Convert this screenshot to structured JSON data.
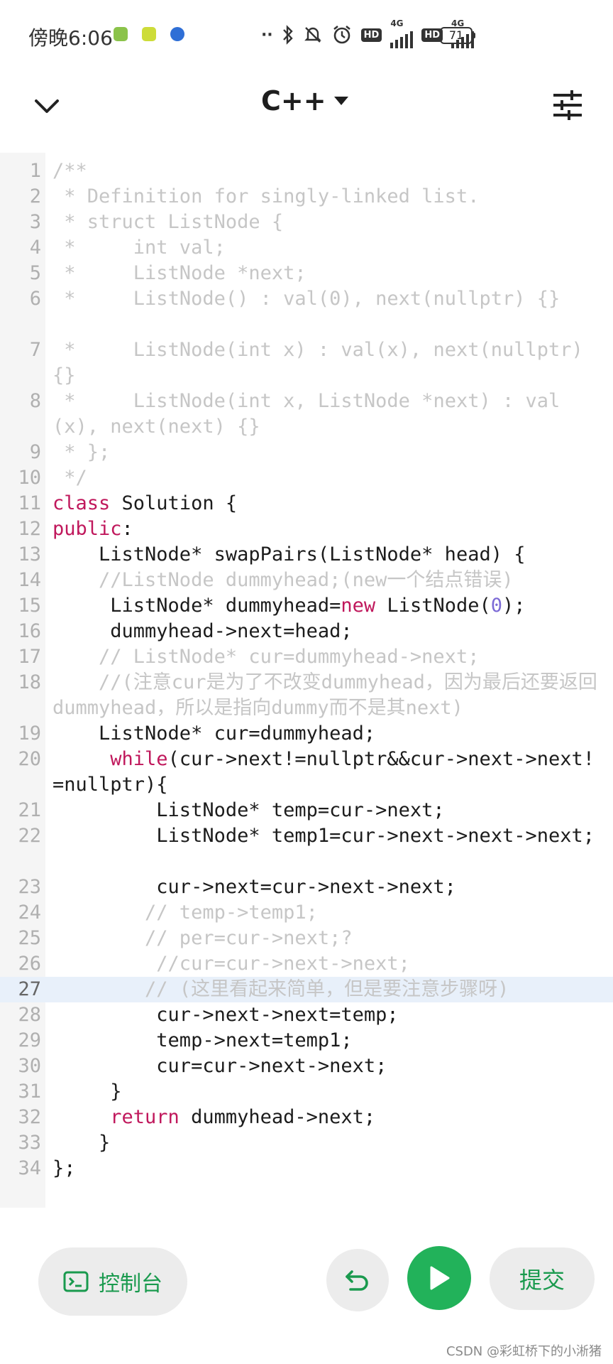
{
  "status_bar": {
    "time": "傍晚6:06",
    "network_1": "4G",
    "network_2": "4G",
    "hd_1": "HD",
    "hd_2": "HD",
    "battery": "71"
  },
  "header": {
    "language": "C++"
  },
  "editor": {
    "active_line": "27",
    "lines": [
      {
        "num": "1",
        "segments": [
          {
            "t": "/**",
            "c": "cm"
          }
        ]
      },
      {
        "num": "2",
        "segments": [
          {
            "t": " * Definition for singly-linked list.",
            "c": "cm"
          }
        ]
      },
      {
        "num": "3",
        "segments": [
          {
            "t": " * struct ListNode {",
            "c": "cm"
          }
        ]
      },
      {
        "num": "4",
        "segments": [
          {
            "t": " *     int val;",
            "c": "cm"
          }
        ]
      },
      {
        "num": "5",
        "segments": [
          {
            "t": " *     ListNode *next;",
            "c": "cm"
          }
        ]
      },
      {
        "num": "6",
        "segments": [
          {
            "t": " *     ListNode() : val(0), next(nullptr) {}",
            "c": "cm"
          }
        ]
      },
      {
        "num": "7",
        "segments": [
          {
            "t": " *     ListNode(int x) : val(x), next(nullptr) {}",
            "c": "cm"
          }
        ]
      },
      {
        "num": "8",
        "segments": [
          {
            "t": " *     ListNode(int x, ListNode *next) : val(x), next(next) {}",
            "c": "cm"
          }
        ]
      },
      {
        "num": "9",
        "segments": [
          {
            "t": " * };",
            "c": "cm"
          }
        ]
      },
      {
        "num": "10",
        "segments": [
          {
            "t": " */",
            "c": "cm"
          }
        ]
      },
      {
        "num": "11",
        "segments": [
          {
            "t": "class",
            "c": "kw"
          },
          {
            "t": " Solution {",
            "c": "pl"
          }
        ]
      },
      {
        "num": "12",
        "segments": [
          {
            "t": "public",
            "c": "kw"
          },
          {
            "t": ":",
            "c": "pl"
          }
        ]
      },
      {
        "num": "13",
        "segments": [
          {
            "t": "    ListNode* swapPairs(ListNode* head) {",
            "c": "pl"
          }
        ]
      },
      {
        "num": "14",
        "segments": [
          {
            "t": "    //ListNode dummyhead;(new一个结点错误)",
            "c": "cm"
          }
        ]
      },
      {
        "num": "15",
        "segments": [
          {
            "t": "     ListNode* dummyhead=",
            "c": "pl"
          },
          {
            "t": "new",
            "c": "kw"
          },
          {
            "t": " ListNode(",
            "c": "pl"
          },
          {
            "t": "0",
            "c": "num"
          },
          {
            "t": ");",
            "c": "pl"
          }
        ]
      },
      {
        "num": "16",
        "segments": [
          {
            "t": "     dummyhead->next=head;",
            "c": "pl"
          }
        ]
      },
      {
        "num": "17",
        "segments": [
          {
            "t": "    // ListNode* cur=dummyhead->next;",
            "c": "cm"
          }
        ]
      },
      {
        "num": "18",
        "segments": [
          {
            "t": "    //(注意cur是为了不改变dummyhead，因为最后还要返回dummyhead，所以是指向dummy而不是其next)",
            "c": "cm"
          }
        ]
      },
      {
        "num": "19",
        "segments": [
          {
            "t": "    ListNode* cur=dummyhead;",
            "c": "pl"
          }
        ]
      },
      {
        "num": "20",
        "segments": [
          {
            "t": "     ",
            "c": "pl"
          },
          {
            "t": "while",
            "c": "kw"
          },
          {
            "t": "(cur->next!=nullptr&&cur->next->next!=nullptr){",
            "c": "pl"
          }
        ]
      },
      {
        "num": "21",
        "segments": [
          {
            "t": "         ListNode* temp=cur->next;",
            "c": "pl"
          }
        ]
      },
      {
        "num": "22",
        "segments": [
          {
            "t": "         ListNode* temp1=cur->next->next->next;",
            "c": "pl"
          }
        ]
      },
      {
        "num": "23",
        "segments": [
          {
            "t": "         cur->next=cur->next->next;",
            "c": "pl"
          }
        ]
      },
      {
        "num": "24",
        "segments": [
          {
            "t": "        // temp->temp1;",
            "c": "cm"
          }
        ]
      },
      {
        "num": "25",
        "segments": [
          {
            "t": "        // per=cur->next;?",
            "c": "cm"
          }
        ]
      },
      {
        "num": "26",
        "segments": [
          {
            "t": "         //cur=cur->next->next;",
            "c": "cm"
          }
        ]
      },
      {
        "num": "27",
        "segments": [
          {
            "t": "        // (这里看起来简单，但是要注意步骤呀)",
            "c": "cm"
          }
        ]
      },
      {
        "num": "28",
        "segments": [
          {
            "t": "         cur->next->next=temp;",
            "c": "pl"
          }
        ]
      },
      {
        "num": "29",
        "segments": [
          {
            "t": "         temp->next=temp1;",
            "c": "pl"
          }
        ]
      },
      {
        "num": "30",
        "segments": [
          {
            "t": "         cur=cur->next->next;",
            "c": "pl"
          }
        ]
      },
      {
        "num": "31",
        "segments": [
          {
            "t": "     }",
            "c": "pl"
          }
        ]
      },
      {
        "num": "32",
        "segments": [
          {
            "t": "     ",
            "c": "pl"
          },
          {
            "t": "return",
            "c": "kw"
          },
          {
            "t": " dummyhead->next;",
            "c": "pl"
          }
        ]
      },
      {
        "num": "33",
        "segments": [
          {
            "t": "    }",
            "c": "pl"
          }
        ]
      },
      {
        "num": "34",
        "segments": [
          {
            "t": "};",
            "c": "pl"
          }
        ]
      }
    ]
  },
  "toolbar": {
    "console_label": "控制台",
    "submit_label": "提交"
  },
  "watermark": "CSDN @彩虹桥下的小淅猪"
}
